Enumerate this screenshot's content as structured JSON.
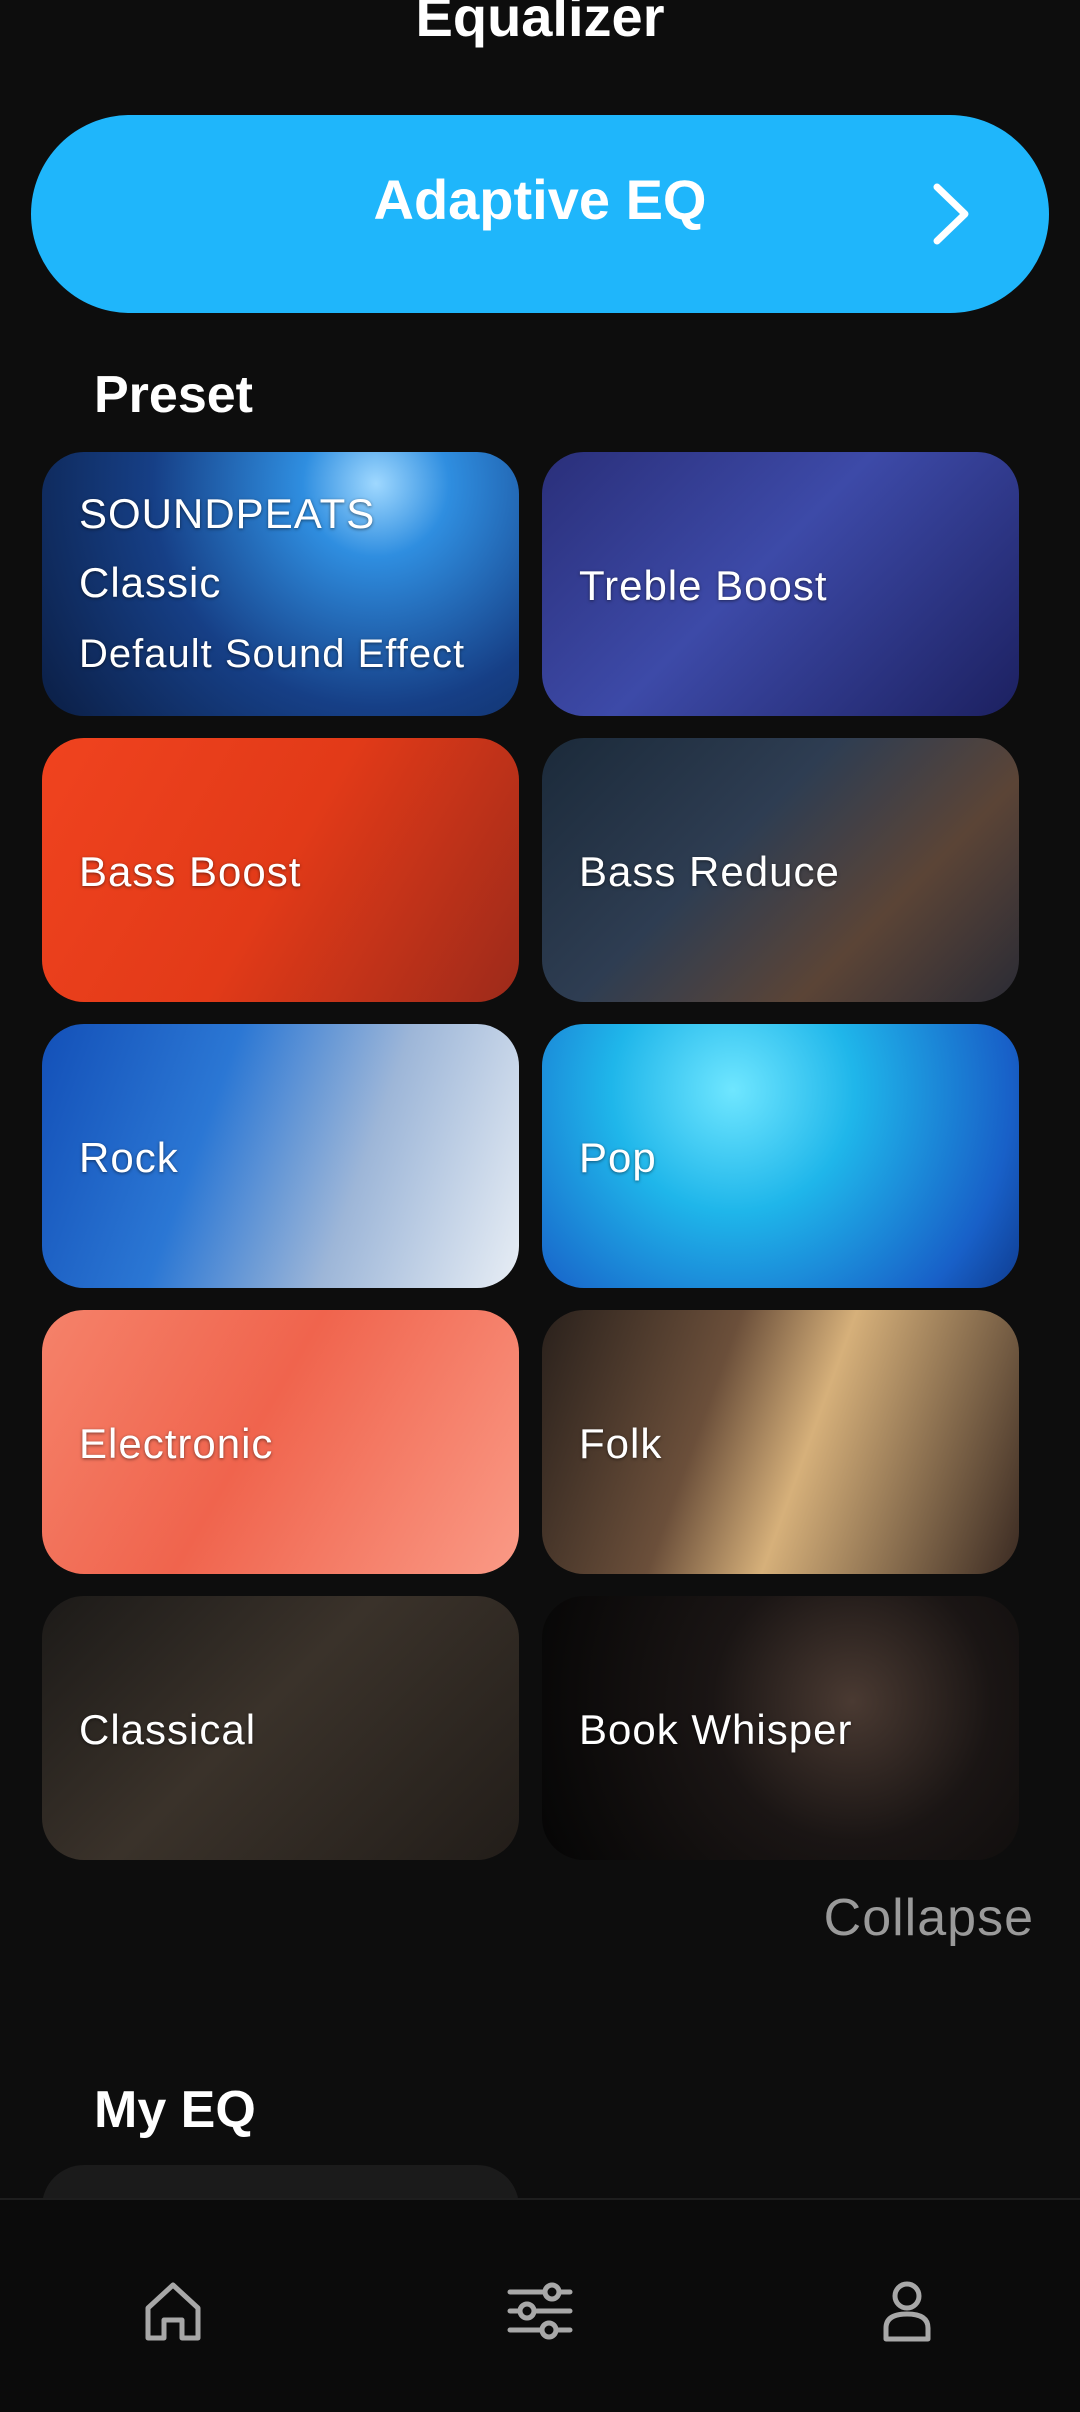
{
  "page": {
    "title": "Equalizer"
  },
  "adaptive_eq": {
    "label": "Adaptive EQ",
    "icon": "chevron-right-icon"
  },
  "preset": {
    "heading": "Preset",
    "cards": [
      {
        "line1": "SOUNDPEATS",
        "line2": "Classic",
        "line3": "Default Sound Effect"
      },
      {
        "label": "Treble Boost"
      },
      {
        "label": "Bass Boost"
      },
      {
        "label": "Bass Reduce"
      },
      {
        "label": "Rock"
      },
      {
        "label": "Pop"
      },
      {
        "label": "Electronic"
      },
      {
        "label": "Folk"
      },
      {
        "label": "Classical"
      },
      {
        "label": "Book Whisper"
      }
    ],
    "collapse_label": "Collapse"
  },
  "my_eq": {
    "heading": "My EQ"
  },
  "bottom_nav": [
    {
      "icon": "home-icon"
    },
    {
      "icon": "equalizer-sliders-icon"
    },
    {
      "icon": "profile-icon"
    }
  ],
  "colors": {
    "accent": "#1fb6fb",
    "background": "#0d0d0d"
  }
}
